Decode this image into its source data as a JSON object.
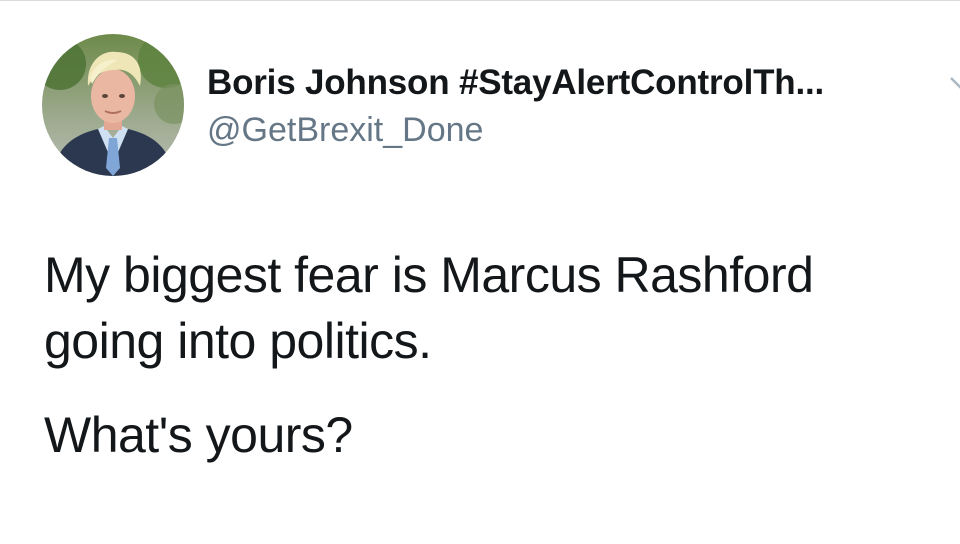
{
  "author": {
    "display_name": "Boris Johnson #StayAlertControlTh...",
    "handle": "@GetBrexit_Done",
    "avatar_icon": "profile-photo"
  },
  "tweet": {
    "paragraphs": [
      "My biggest fear is Marcus Rashford going into politics.",
      "What's yours?"
    ]
  },
  "colors": {
    "text": "#14171a",
    "secondary_text": "#657786",
    "background": "#ffffff"
  }
}
